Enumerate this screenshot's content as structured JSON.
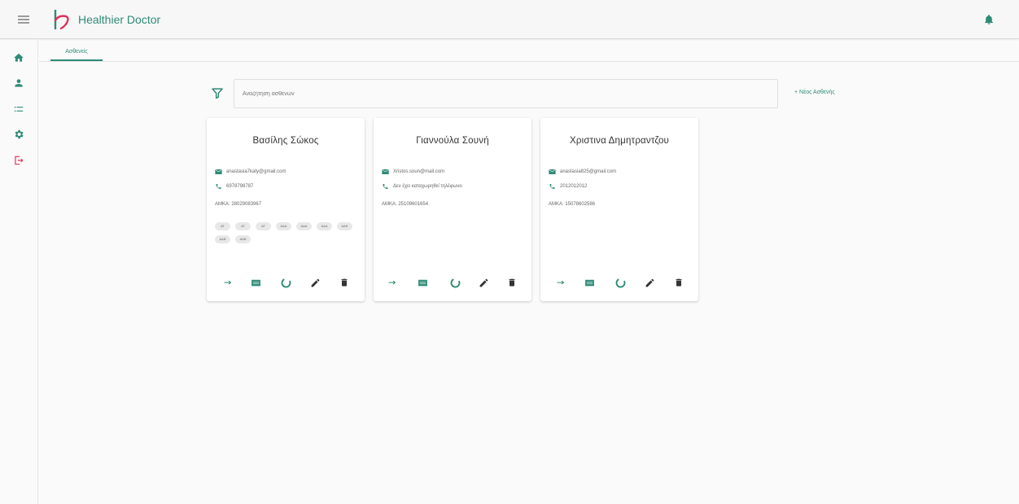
{
  "app": {
    "title": "Healthier Doctor"
  },
  "colors": {
    "accent": "#2e8b76",
    "danger": "#e0305a",
    "icon": "#333333"
  },
  "tabs": [
    {
      "label": "Ασθενείς"
    }
  ],
  "search": {
    "placeholder": "Αναζήτηση ασθενών",
    "value": ""
  },
  "new_patient_label": "+ Νέος Ασθενής",
  "sidebar": {
    "items": [
      {
        "icon": "home-icon"
      },
      {
        "icon": "person-icon"
      },
      {
        "icon": "list-icon"
      },
      {
        "icon": "settings-icon"
      },
      {
        "icon": "logout-icon"
      }
    ]
  },
  "patients": [
    {
      "name": "Βασίλης Σώκος",
      "email": "anastasia7katy@gmail.com",
      "phone": "6978798787",
      "amka": "ΑΜΚΑ: 28029083967",
      "tags": [
        "ΑΤ",
        "ΑΤ",
        "ΑΤ",
        "ΑΑΑ",
        "ΑΑΑ",
        "ΑΑΑ",
        "ΑΑΕ",
        "ΑΑΒ",
        "ΑΑΒ"
      ]
    },
    {
      "name": "Γιαννούλα Σουνή",
      "email": "Xristos.soun@mail.com",
      "phone": "Δεν έχει καταχωρηθεί τηλέφωνο",
      "amka": "ΑΜΚΑ: 25109601654",
      "tags": []
    },
    {
      "name": "Χριστινα Δημητραντζου",
      "email": "anastasia825@gmail.com",
      "phone": "2012012012",
      "amka": "ΑΜΚΑ: 15078602586",
      "tags": []
    }
  ]
}
